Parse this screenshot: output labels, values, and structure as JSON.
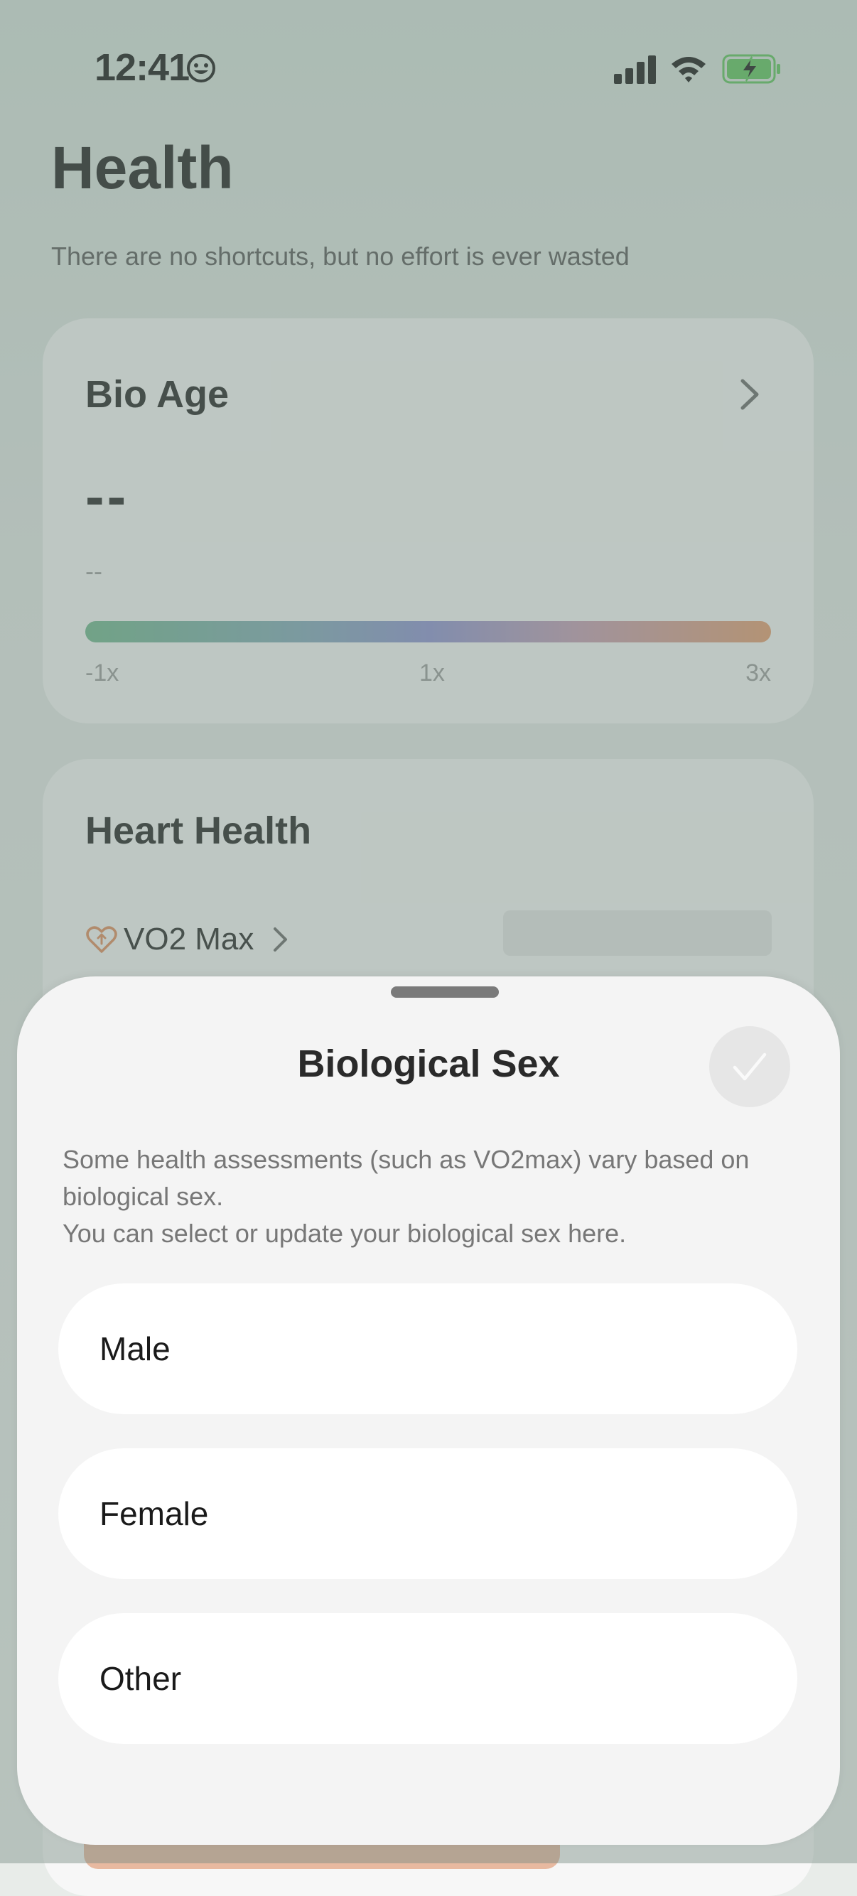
{
  "status_bar": {
    "time": "12:41"
  },
  "header": {
    "title": "Health",
    "subtitle": "There are no shortcuts, but no effort is ever wasted"
  },
  "bio_age": {
    "title": "Bio Age",
    "value": "--",
    "sub_value": "--",
    "scale_labels": [
      "-1x",
      "1x",
      "3x"
    ]
  },
  "heart_health": {
    "title": "Heart Health",
    "vo2_label": "VO2 Max"
  },
  "sheet": {
    "title": "Biological Sex",
    "description_lines": [
      "Some health assessments (such as VO2max) vary based on biological sex.",
      "You can select or update your biological sex here."
    ],
    "options": [
      "Male",
      "Female",
      "Other"
    ]
  },
  "colors": {
    "battery": "#5cc45a",
    "heart_icon": "#e08a5a",
    "gradient": [
      "#6cb58a",
      "#8a8fd0",
      "#e49a6a"
    ]
  },
  "icons": [
    "smiley-icon",
    "signal-icon",
    "wifi-icon",
    "battery-charging-icon",
    "chevron-right-icon",
    "heart-arrow-icon",
    "checkmark-icon"
  ]
}
